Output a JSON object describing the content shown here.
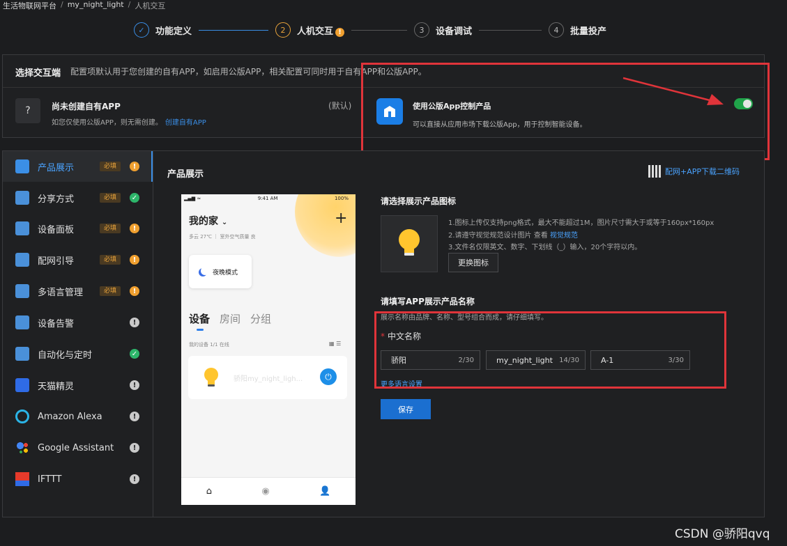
{
  "breadcrumb": {
    "items": [
      "生活物联网平台",
      "my_night_light",
      "人机交互"
    ],
    "sep": "/"
  },
  "steps": [
    {
      "num": "✓",
      "label": "功能定义",
      "state": "done"
    },
    {
      "num": "2",
      "label": "人机交互",
      "state": "active",
      "warn": "!"
    },
    {
      "num": "3",
      "label": "设备调试",
      "state": "todo"
    },
    {
      "num": "4",
      "label": "批量投产",
      "state": "todo"
    }
  ],
  "interaction_end": {
    "title": "选择交互端",
    "desc": "配置项默认用于您创建的自有APP，如启用公版APP，相关配置可同时用于自有APP和公版APP。",
    "own_app": {
      "icon": "?",
      "title": "尚未创建自有APP",
      "desc": "如您仅使用公版APP，则无需创建。",
      "link": "创建自有APP",
      "default_tag": "(默认)"
    },
    "public_app": {
      "title": "使用公版App控制产品",
      "desc": "可以直接从应用市场下载公版App，用于控制智能设备。",
      "enabled": true
    }
  },
  "sidebar": {
    "items": [
      {
        "label": "产品展示",
        "required": "必填",
        "status": "warn",
        "icon_color": "#3b8fe6",
        "active": true
      },
      {
        "label": "分享方式",
        "required": "必填",
        "status": "ok",
        "icon_color": "#4a90d9"
      },
      {
        "label": "设备面板",
        "required": "必填",
        "status": "warn",
        "icon_color": "#4a90d9"
      },
      {
        "label": "配网引导",
        "required": "必填",
        "status": "warn",
        "icon_color": "#4a90d9"
      },
      {
        "label": "多语言管理",
        "required": "必填",
        "status": "warn",
        "icon_color": "#4a90d9"
      },
      {
        "label": "设备告警",
        "status": "info",
        "icon_color": "#4a90d9"
      },
      {
        "label": "自动化与定时",
        "status": "ok",
        "icon_color": "#4a90d9"
      },
      {
        "label": "天猫精灵",
        "status": "info",
        "icon_color": "#2f6be6"
      },
      {
        "label": "Amazon Alexa",
        "status": "info",
        "icon_color": "#2bb4e6"
      },
      {
        "label": "Google Assistant",
        "status": "info",
        "icon_color": "#e94235"
      },
      {
        "label": "IFTTT",
        "status": "info",
        "icon_color": "#e63a2b"
      }
    ],
    "status_glyphs": {
      "warn": "!",
      "ok": "✓",
      "info": "!"
    }
  },
  "main": {
    "section_title": "产品展示",
    "qr_link": "配网+APP下载二维码",
    "phone": {
      "time": "9:41 AM",
      "battery": "100%",
      "signal": "▂▄▆ ≈",
      "home": "我的家",
      "home_chevron": "⌄",
      "plus": "+",
      "weather": "多云 27℃  ｜ 室外空气质量 良",
      "night_mode": "夜晚模式",
      "tabs": [
        "设备",
        "房间",
        "分组"
      ],
      "my_devices": "我的设备   1/1 在线",
      "view_icons": "▦ ☰",
      "device_name": "骄阳my_night_ligh...",
      "power": "⏻",
      "nav": [
        "⌂",
        "◉",
        "👤"
      ]
    },
    "icon_section": {
      "title": "请选择展示产品图标",
      "rules": [
        "1.图标上传仅支持png格式，最大不能超过1M，图片尺寸需大于或等于160px*160px",
        "2.请遵守视觉规范设计图片 查看 ",
        "3.文件名仅限英文、数字、下划线（_）输入，20个字符以内。"
      ],
      "rules_link": "视觉规范",
      "change_button": "更换图标"
    },
    "name_section": {
      "title": "请填写APP展示产品名称",
      "hint": "展示名称由品牌、名称、型号组合而成，请仔细填写。",
      "label": "中文名称",
      "required_mark": "*",
      "fields": [
        {
          "value": "骄阳",
          "count": "2/30"
        },
        {
          "value": "my_night_light",
          "count": "14/30"
        },
        {
          "value": "A-1",
          "count": "3/30"
        }
      ],
      "more_lang": "更多语言设置",
      "save_button": "保存"
    }
  },
  "watermark": "CSDN @骄阳qvq",
  "colors": {
    "accent": "#3a8ee6",
    "warn": "#f0a030",
    "ok": "#2db56a",
    "highlight": "#e0343a",
    "toggle_on": "#20a34a"
  }
}
